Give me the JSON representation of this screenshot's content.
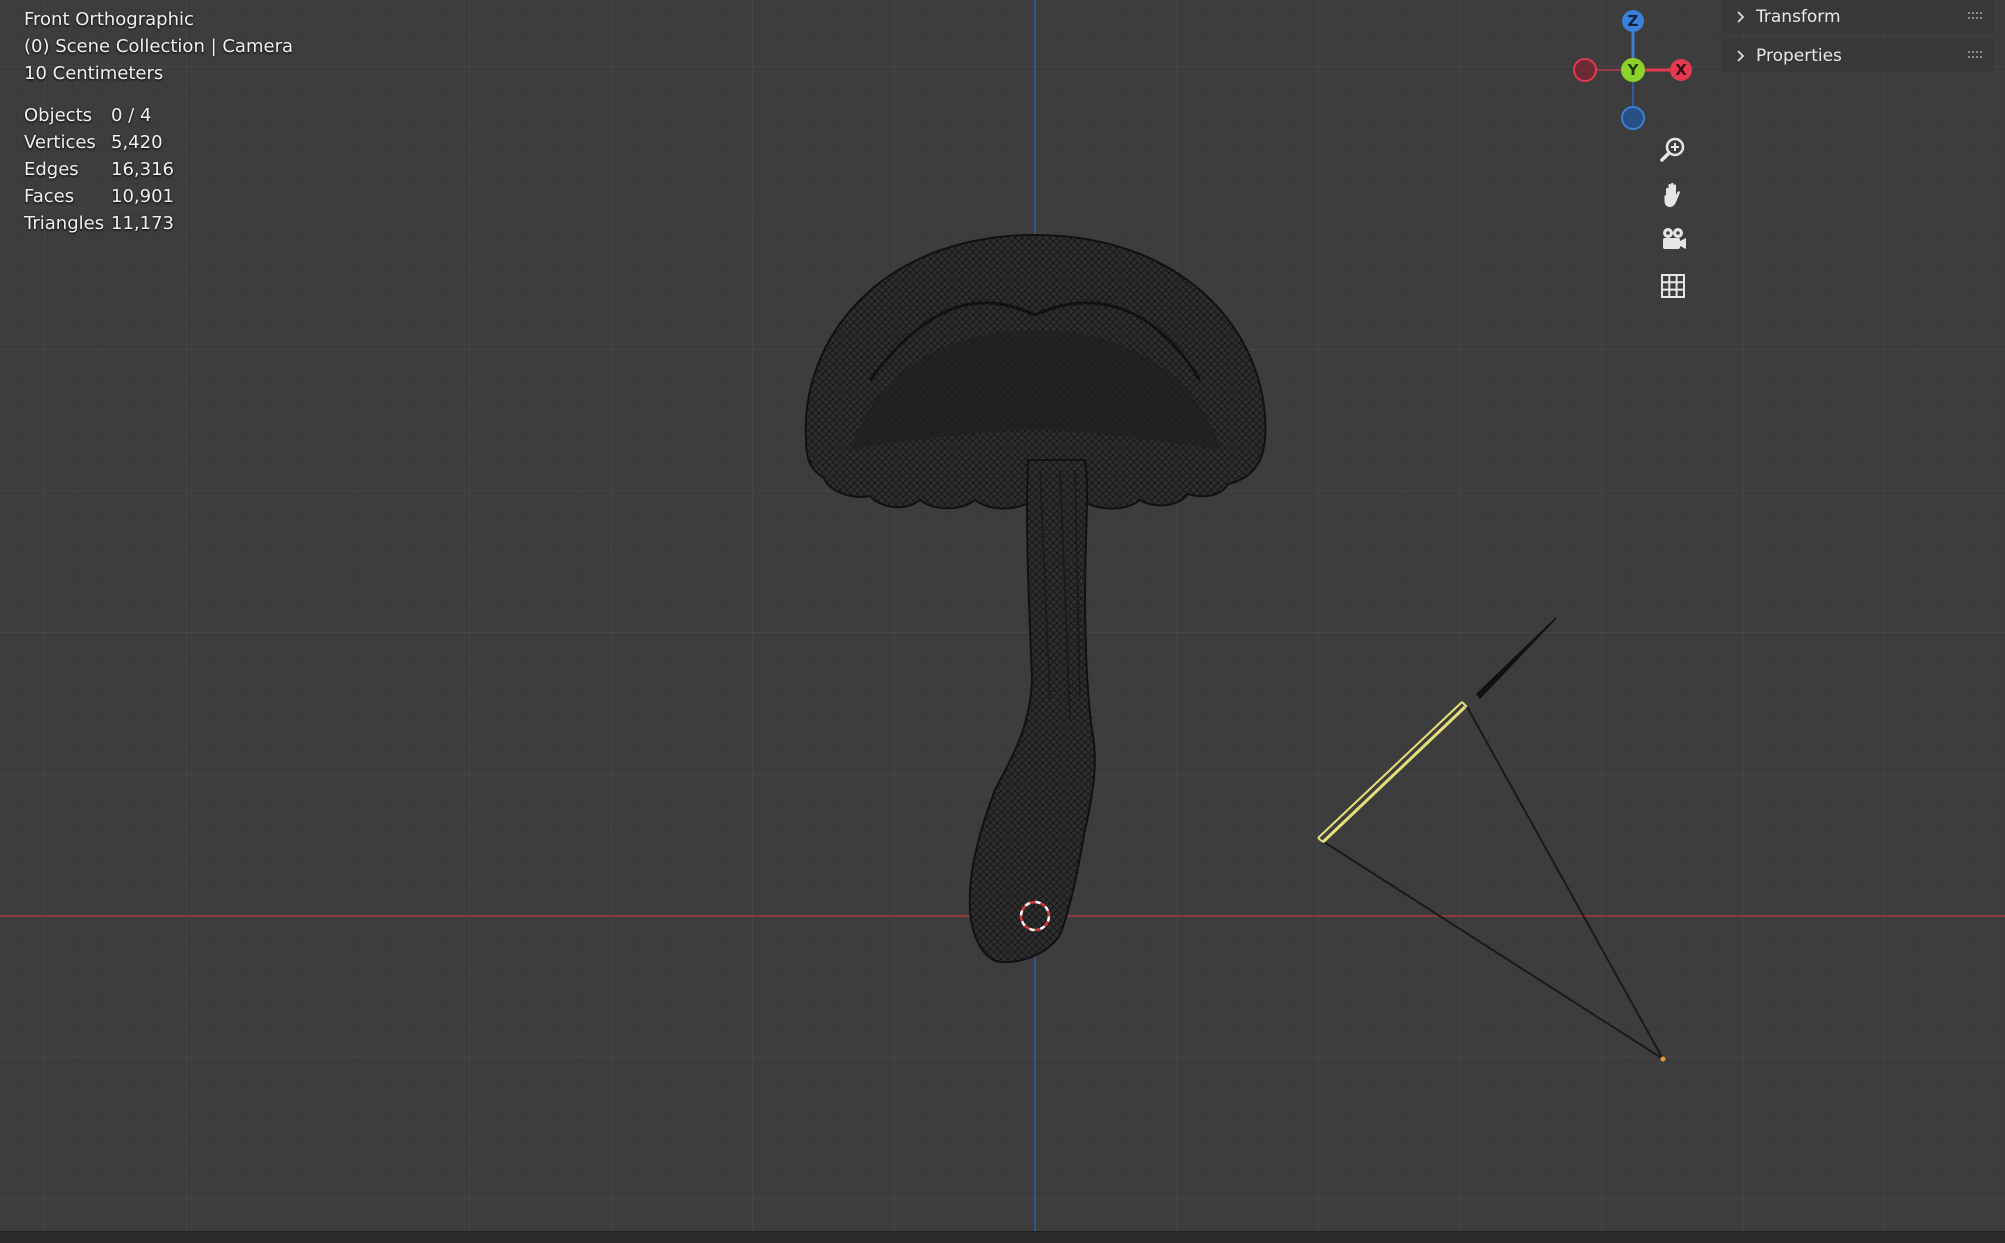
{
  "viewport": {
    "view_name": "Front Orthographic",
    "collection": "(0) Scene Collection | Camera",
    "scale": "10 Centimeters",
    "stats": [
      {
        "label": "Objects",
        "value": "0 / 4"
      },
      {
        "label": "Vertices",
        "value": "5,420"
      },
      {
        "label": "Edges",
        "value": "16,316"
      },
      {
        "label": "Faces",
        "value": "10,901"
      },
      {
        "label": "Triangles",
        "value": "11,173"
      }
    ]
  },
  "sidebar": {
    "panels": [
      {
        "label": "Transform",
        "icon": "chevron-right-icon"
      },
      {
        "label": "Properties",
        "icon": "chevron-right-icon"
      }
    ]
  },
  "gizmo": {
    "z_label": "Z",
    "y_label": "Y",
    "x_label": "X",
    "colors": {
      "x": "#e5394f",
      "y": "#8bd22c",
      "z": "#3b7fd6"
    }
  },
  "nav_buttons": [
    {
      "name": "zoom-icon"
    },
    {
      "name": "hand-pan-icon"
    },
    {
      "name": "camera-view-icon"
    },
    {
      "name": "grid-ortho-icon"
    }
  ],
  "colors": {
    "background": "#3d3d3d",
    "x_axis": "#b03a3a",
    "z_axis": "#2f5d9c",
    "camera_active": "#e6e07a"
  }
}
